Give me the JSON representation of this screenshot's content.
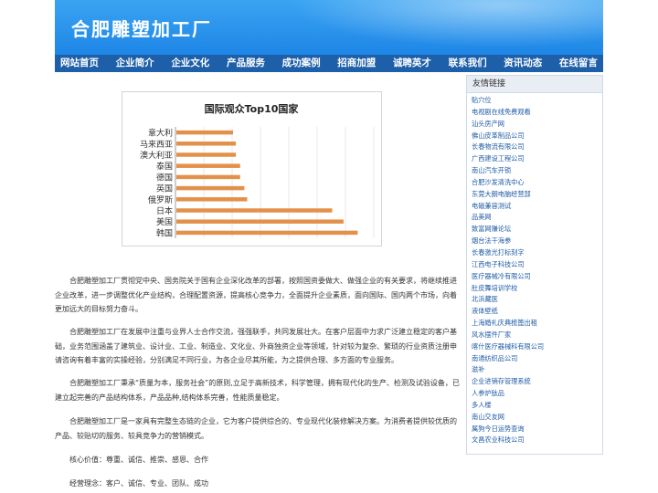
{
  "header": {
    "title": "合肥雕塑加工厂"
  },
  "nav": [
    "网站首页",
    "企业简介",
    "企业文化",
    "产品服务",
    "成功案例",
    "招商加盟",
    "诚聘英才",
    "联系我们",
    "资讯动态",
    "在线留言"
  ],
  "chart_data": {
    "type": "bar",
    "orientation": "horizontal",
    "title": "国际观众Top10国家",
    "categories": [
      "意大利",
      "马来西亚",
      "澳大利亚",
      "泰国",
      "德国",
      "英国",
      "俄罗斯",
      "日本",
      "美国",
      "韩国"
    ],
    "values": [
      40,
      42,
      42,
      45,
      45,
      48,
      50,
      110,
      118,
      128
    ],
    "xlim": [
      0,
      140
    ],
    "grid": true,
    "bar_color": "#e3914a"
  },
  "paragraphs": [
    "合肥雕塑加工厂贯彻党中央、国务院关于国有企业深化改革的部署，按照国资委做大、做强企业的有关要求，将继续推进企业改革，进一步调整优化产业结构，合理配置资源，提高核心竞争力，全面提升企业素质，面向国际、国内两个市场，向着更加远大的目标努力奋斗。",
    "合肥雕塑加工厂在发展中注重与业界人士合作交流，强强联手，共同发展壮大。在客户层面中力求广泛建立稳定的客户基础，业务范围涵盖了建筑业、设计业、工业、制造业、文化业、外商独资企业等领域，针对较为复杂、繁琐的行业资质注册申请咨询有着丰富的实操经验，分别满足不同行业，为各企业尽其所能，为之提供合理、多方面的专业服务。",
    "合肥雕塑加工厂秉承“质量为本，服务社会”的原则,立足于高新技术，科学管理，拥有现代化的生产、检测及试验设备，已建立起完善的产品结构体系，产品品种,结构体系完善，性能质量稳定。",
    "合肥雕塑加工厂是一家具有完整生态链的企业，它为客户提供综合的、专业现代化装修解决方案。为消费者提供较优质的产品、较贴切的服务、较具竞争力的营销模式。",
    "核心价值：尊重、诚信、推崇、感恩、合作",
    "经营理念：客户、诚信、专业、团队、成功"
  ],
  "sidebar": {
    "title": "友情链接",
    "links": [
      "贴穴位",
      "电视剧在线免费观看",
      "汕头房产网",
      "佛山皮革制品公司",
      "长春物流有限公司",
      "广西建设工程公司",
      "南山汽车开锁",
      "合肥沙发清洗中心",
      "东莞大朗电脑经营部",
      "电磁兼容测试",
      "品美网",
      "致富网赚论坛",
      "烟台法干海参",
      "长春激光打标刻字",
      "江西电子科技公司",
      "医疗器械冷有限公司",
      "肚皮舞培训学校",
      "北浜藏医",
      "液体壁纸",
      "上海婚礼庆典梳篦出租",
      "风水摆件厂家",
      "喀什医疗器械科有限公司",
      "南通纺织品公司",
      "滋补",
      "企业进销存管理系统",
      "人参炉肽品",
      "多人楼",
      "南山交友网",
      "属狗今日运势查询",
      "文昌农业科技公司"
    ]
  }
}
